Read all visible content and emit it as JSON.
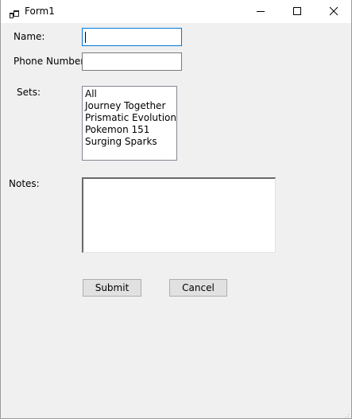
{
  "window": {
    "title": "Form1",
    "app_icon": "windows-form-icon",
    "controls": {
      "minimize_icon": "minimize-icon",
      "maximize_icon": "maximize-icon",
      "close_icon": "close-icon"
    }
  },
  "form": {
    "name": {
      "label": "Name:",
      "value": ""
    },
    "phone": {
      "label": "Phone Number:",
      "value": ""
    },
    "sets": {
      "label": "Sets:",
      "options": [
        "All",
        "Journey Together",
        "Prismatic Evolution",
        "Pokemon 151",
        "Surging Sparks"
      ]
    },
    "notes": {
      "label": "Notes:",
      "value": ""
    },
    "buttons": {
      "submit_label": "Submit",
      "cancel_label": "Cancel"
    }
  },
  "colors": {
    "form_background": "#f0f0f0",
    "titlebar_background": "#ffffff",
    "focus_border": "#0078d7",
    "button_face": "#e1e1e1",
    "button_border": "#adadad"
  }
}
